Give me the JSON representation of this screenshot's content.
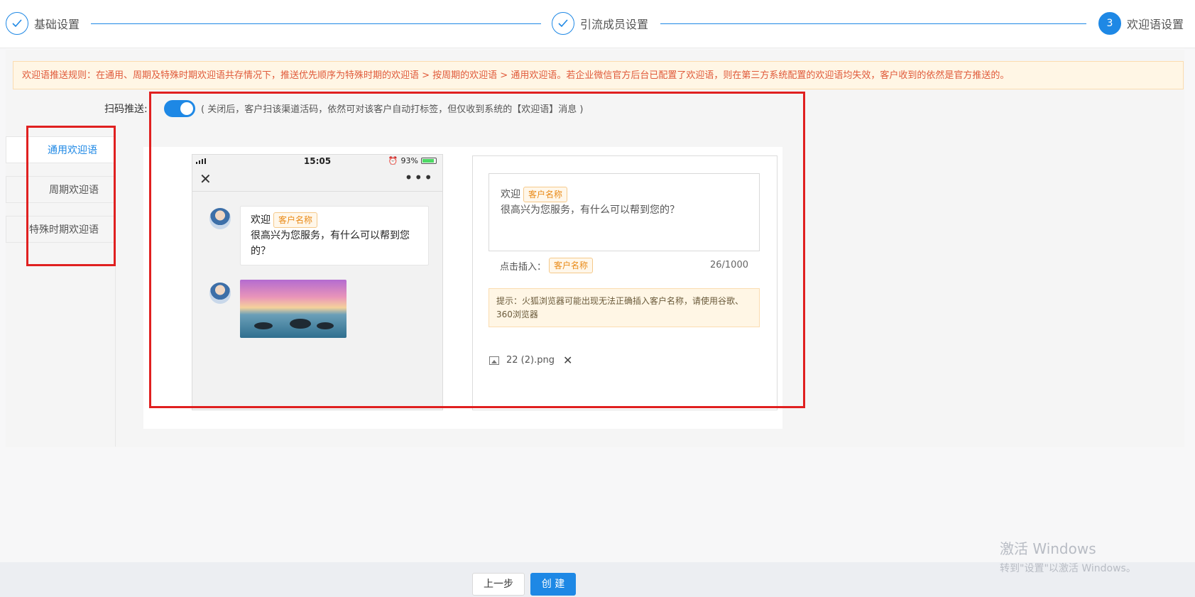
{
  "steps": [
    {
      "label": "基础设置",
      "icon": "check-icon"
    },
    {
      "label": "引流成员设置",
      "icon": "check-icon"
    },
    {
      "number": "3",
      "label": "欢迎语设置"
    }
  ],
  "rules_text": "欢迎语推送规则：在通用、周期及特殊时期欢迎语共存情况下，推送优先顺序为特殊时期的欢迎语 > 按周期的欢迎语 > 通用欢迎语。若企业微信官方后台已配置了欢迎语，则在第三方系统配置的欢迎语均失效，客户收到的依然是官方推送的。",
  "push": {
    "label": "扫码推送:",
    "enabled": true,
    "note": "( 关闭后，客户扫该渠道活码，依然可对该客户自动打标签，但仅收到系统的【欢迎语】消息 )"
  },
  "tabs": [
    {
      "label": "通用欢迎语",
      "active": true
    },
    {
      "label": "周期欢迎语",
      "active": false
    },
    {
      "label": "特殊时期欢迎语",
      "active": false
    }
  ],
  "phone": {
    "time": "15:05",
    "battery": "93%",
    "alarm_icon": "⏰",
    "message": {
      "prefix": "欢迎",
      "chip": "客户名称",
      "body": "很高兴为您服务，有什么可以帮到您的？"
    }
  },
  "editor": {
    "prefix": "欢迎",
    "chip": "客户名称",
    "body": "很高兴为您服务，有什么可以帮到您的？",
    "insert_label": "点击插入：",
    "insert_chip": "客户名称",
    "counter": "26/1000",
    "tip": "提示：火狐浏览器可能出现无法正确插入客户名称，请使用谷歌、360浏览器",
    "file_name": "22 (2).png"
  },
  "footer": {
    "prev_label": "上一步",
    "create_label": "创 建"
  },
  "watermark": {
    "line1": "激活 Windows",
    "line2": "转到\"设置\"以激活 Windows。"
  },
  "colors": {
    "accent": "#1e88e5",
    "warning_text": "#e05a3a",
    "chip": "#e98a17",
    "annotation": "#e02020"
  }
}
